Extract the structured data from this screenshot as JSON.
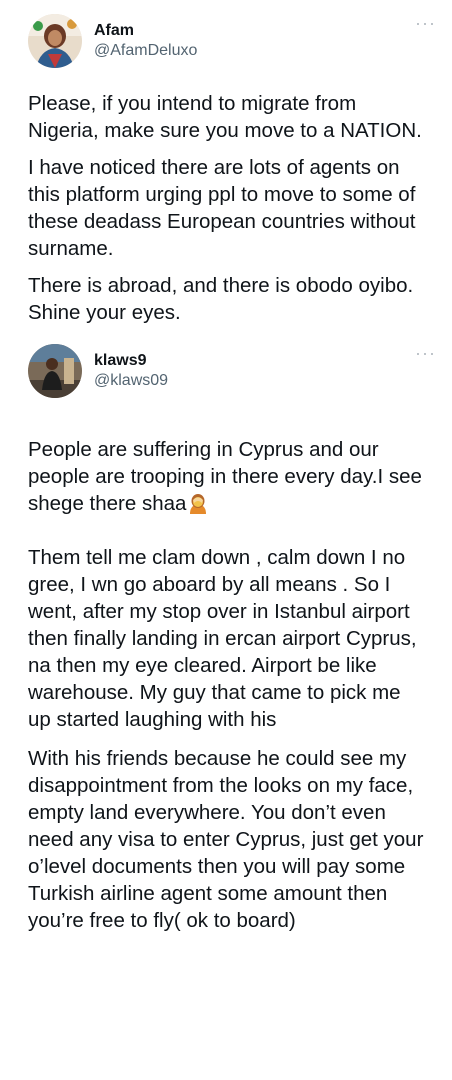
{
  "tweet1": {
    "display_name": "Afam",
    "handle": "@AfamDeluxo",
    "more_icon": "···",
    "paragraphs": [
      "Please, if you intend to migrate from Nigeria, make sure you move to a NATION.",
      "I have noticed there are lots of agents on this platform urging ppl to move to some of these deadass European countries without surname.",
      "There is abroad, and there is obodo oyibo. Shine your eyes."
    ]
  },
  "tweet2": {
    "display_name": "klaws9",
    "handle": "@klaws09",
    "more_icon": "···",
    "paragraph1": "People are suffering in Cyprus and our people are trooping in there every day.I see shege there shaa",
    "paragraph1_emoji": "woman-facepalming-emoji",
    "paragraph2": "Them tell me clam down , calm down I no gree, I wn go aboard by all means . So I went, after my stop over in Istanbul airport then finally landing in ercan airport Cyprus, na then my eye cleared. Airport be like warehouse. My guy that came to pick me up started laughing with his",
    "paragraph3": "With his friends because he could see my disappointment from the looks on my face, empty land everywhere. You don’t even need any visa to enter Cyprus, just get your o’level documents then you will pay some Turkish airline agent some amount then you’re free to fly( ok to board)"
  }
}
